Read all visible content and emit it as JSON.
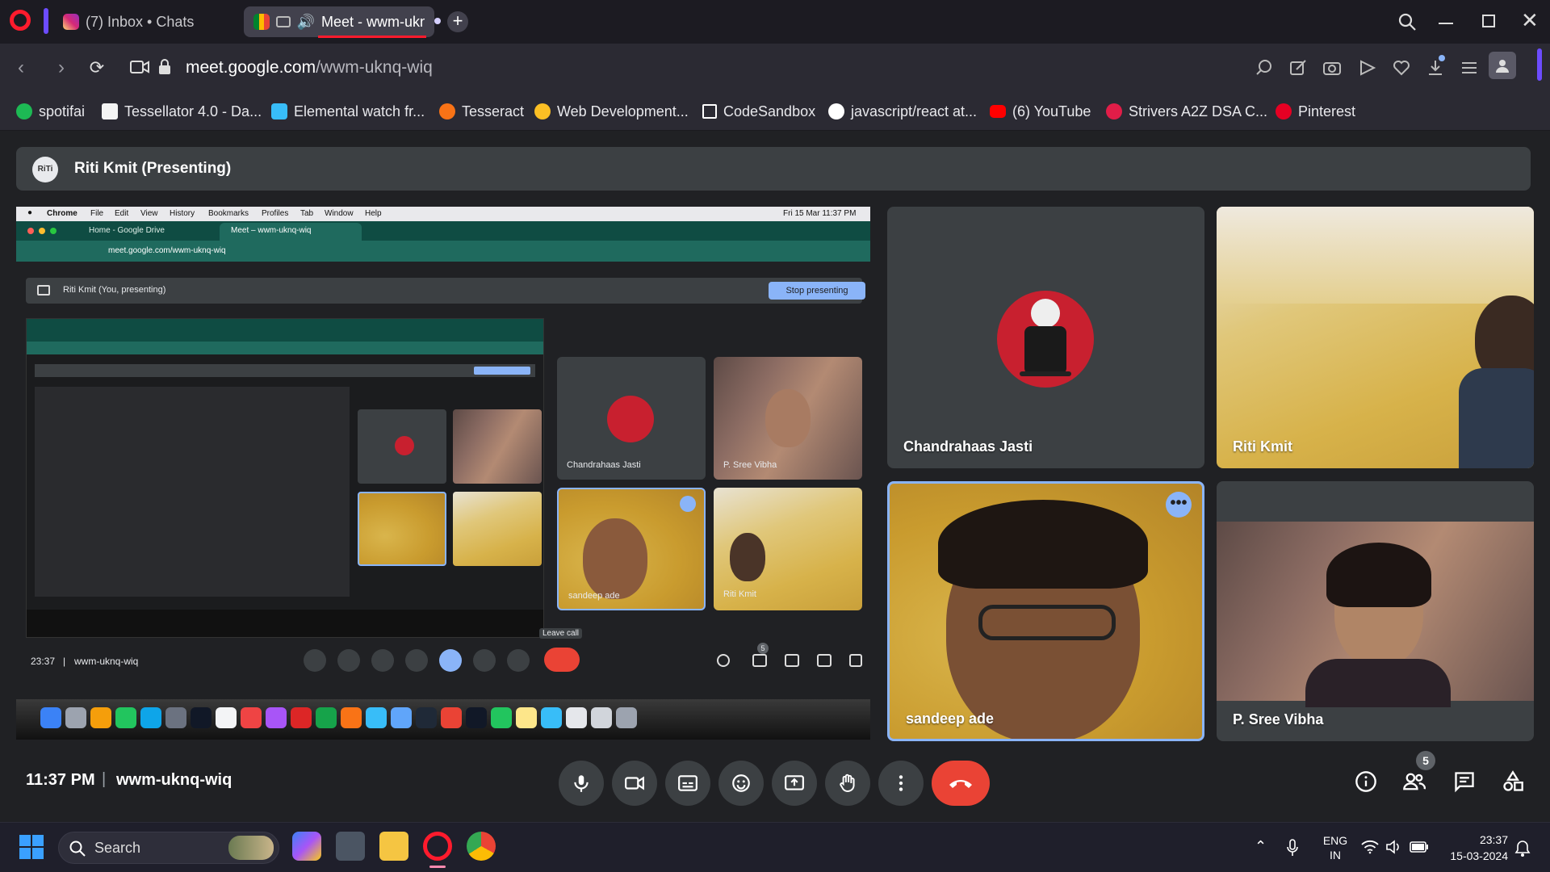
{
  "browser": {
    "tabs": [
      {
        "label": "(7) Inbox • Chats"
      },
      {
        "label": "Meet - wwm-ukn"
      }
    ],
    "url_domain": "meet.google.com",
    "url_path": "/wwm-uknq-wiq",
    "bookmarks": [
      {
        "label": "spotifai",
        "color": "#1db954"
      },
      {
        "label": "Tessellator 4.0 - Da...",
        "color": "#f4f4f4"
      },
      {
        "label": "Elemental watch fr...",
        "color": "#38bdf8"
      },
      {
        "label": "Tesseract",
        "color": "#f97316"
      },
      {
        "label": "Web Development...",
        "color": "#fbbf24"
      },
      {
        "label": "CodeSandbox",
        "color": "#ffffff"
      },
      {
        "label": "javascript/react at...",
        "color": "#ffffff"
      },
      {
        "label": "(6) YouTube",
        "color": "#ff0000"
      },
      {
        "label": "Strivers A2Z DSA C...",
        "color": "#e11d48"
      },
      {
        "label": "Pinterest",
        "color": "#e60023"
      }
    ]
  },
  "meet": {
    "presenter_banner": "Riti Kmit (Presenting)",
    "presenter_avatar_text": "RiTi",
    "participants": [
      {
        "name": "Chandrahaas Jasti"
      },
      {
        "name": "Riti Kmit"
      },
      {
        "name": "sandeep ade"
      },
      {
        "name": "P. Sree Vibha"
      }
    ],
    "time": "11:37 PM",
    "separator": "|",
    "meeting_code": "wwm-uknq-wiq",
    "people_count": "5",
    "end_call_color": "#ea4335"
  },
  "shared_screen": {
    "menubar": [
      "Chrome",
      "File",
      "Edit",
      "View",
      "History",
      "Bookmarks",
      "Profiles",
      "Tab",
      "Window",
      "Help"
    ],
    "clock": "Fri 15 Mar  11:37 PM",
    "tab1": "Home - Google Drive",
    "tab2": "Meet – wwm-uknq-wiq",
    "url": "meet.google.com/wwm-uknq-wiq",
    "presenting_text": "Riti Kmit (You, presenting)",
    "stop_button": "Stop presenting",
    "tile_names": [
      "Chandrahaas Jasti",
      "P. Sree Vibha",
      "sandeep ade",
      "Riti Kmit"
    ],
    "time": "23:37",
    "code": "wwm-uknq-wiq",
    "tooltip": "Leave call",
    "people_count": "5"
  },
  "taskbar": {
    "search_placeholder": "Search",
    "lang_top": "ENG",
    "lang_bottom": "IN",
    "time": "23:37",
    "date": "15-03-2024"
  }
}
